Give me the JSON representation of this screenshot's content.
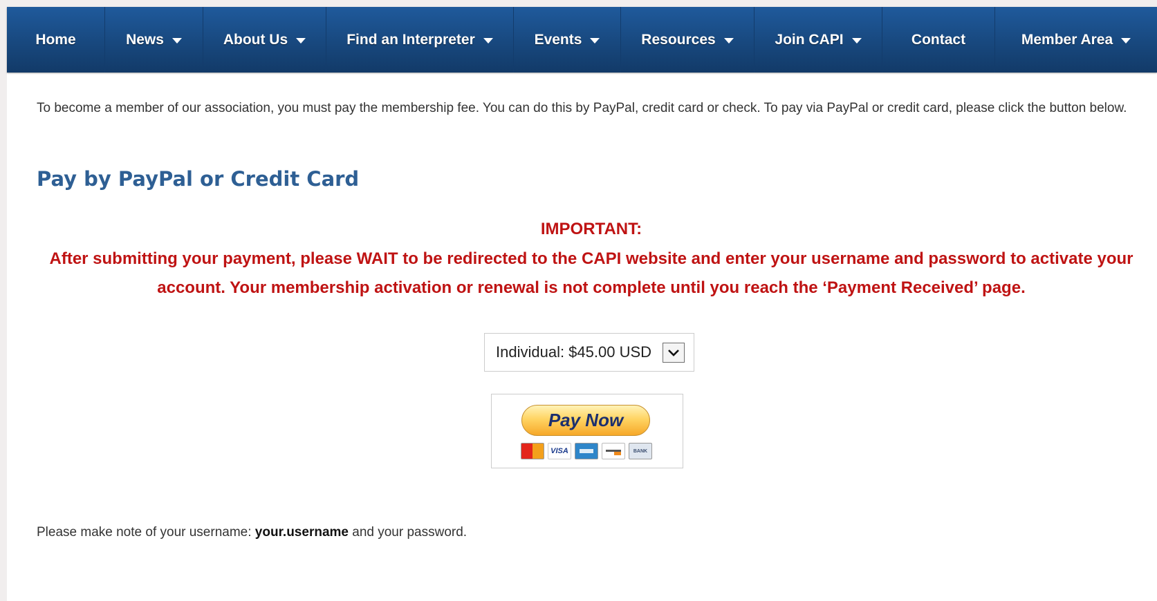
{
  "nav": {
    "items": [
      {
        "label": "Home",
        "dropdown": false
      },
      {
        "label": "News",
        "dropdown": true
      },
      {
        "label": "About Us",
        "dropdown": true
      },
      {
        "label": "Find an Interpreter",
        "dropdown": true
      },
      {
        "label": "Events",
        "dropdown": true
      },
      {
        "label": "Resources",
        "dropdown": true
      },
      {
        "label": "Join CAPI",
        "dropdown": true
      },
      {
        "label": "Contact",
        "dropdown": false
      },
      {
        "label": "Member Area",
        "dropdown": true
      }
    ]
  },
  "intro_text": "To become a member of our association, you must pay the membership fee. You can do this by PayPal, credit card or check. To pay via PayPal or credit card, please click the button below.",
  "section_title": "Pay by PayPal or Credit Card",
  "important": {
    "title": "IMPORTANT:",
    "body": "After submitting your payment, please WAIT to be redirected to the CAPI website and enter your username and password to activate your account. Your membership activation or renewal is not complete until you reach the ‘Payment Received’ page."
  },
  "membership_select": {
    "value": "Individual: $45.00 USD"
  },
  "paypal": {
    "button_label": "Pay Now",
    "cards": [
      "mastercard-icon",
      "visa-icon",
      "amex-icon",
      "discover-icon",
      "bank-icon"
    ],
    "card_labels": {
      "visa": "VISA",
      "bank": "BANK"
    }
  },
  "note": {
    "prefix": "Please make note of your username: ",
    "username": "your.username",
    "suffix": " and your password."
  },
  "colors": {
    "nav_bg": "#18487e",
    "title_blue": "#2e5f94",
    "important_red": "#bf1313"
  }
}
